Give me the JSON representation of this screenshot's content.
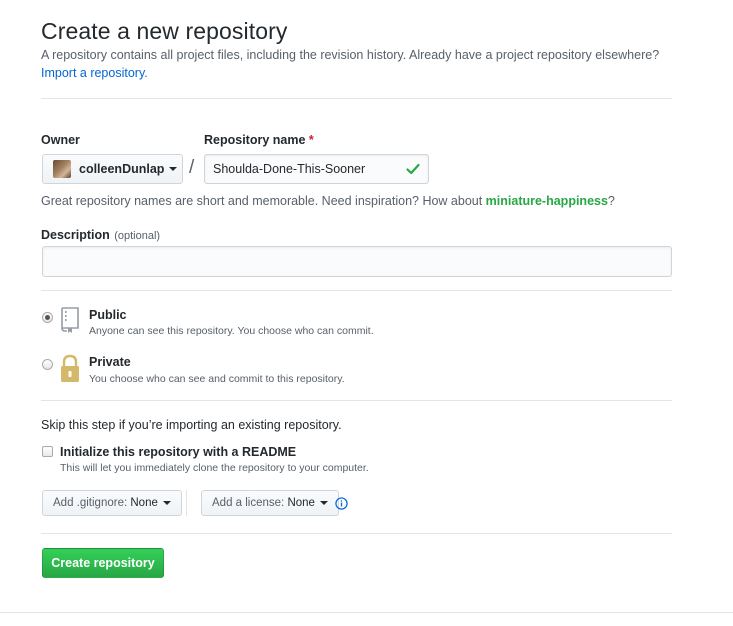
{
  "page": {
    "title": "Create a new repository",
    "subtitle": "A repository contains all project files, including the revision history. Already have a project repository elsewhere?",
    "import_link": "Import a repository",
    "import_link_suffix": "."
  },
  "owner": {
    "label": "Owner",
    "selected": "colleenDunlap"
  },
  "repo_name": {
    "label": "Repository name",
    "required_mark": "*",
    "value": "Shoulda-Done-This-Sooner",
    "valid": true
  },
  "separator": "/",
  "hint": {
    "text": "Great repository names are short and memorable. Need inspiration? How about ",
    "suggestion": "miniature-happiness",
    "suffix": "?"
  },
  "description": {
    "label": "Description",
    "optional": "(optional)",
    "value": ""
  },
  "visibility": {
    "selected": "public",
    "options": [
      {
        "id": "public",
        "title": "Public",
        "desc": "Anyone can see this repository. You choose who can commit."
      },
      {
        "id": "private",
        "title": "Private",
        "desc": "You choose who can see and commit to this repository."
      }
    ]
  },
  "init": {
    "skip_text": "Skip this step if you’re importing an existing repository.",
    "readme_label": "Initialize this repository with a README",
    "readme_desc": "This will let you immediately clone the repository to your computer.",
    "readme_checked": false
  },
  "gitignore": {
    "label": "Add .gitignore:",
    "value": "None"
  },
  "license": {
    "label": "Add a license:",
    "value": "None"
  },
  "submit_label": "Create repository",
  "colors": {
    "link": "#0366d6",
    "success_green": "#28a745",
    "required_red": "#cb2431",
    "private_lock": "#d4b96a"
  },
  "icons": {
    "check": "check-icon",
    "repo": "repo-book-icon",
    "lock": "lock-icon",
    "info": "info-icon"
  }
}
